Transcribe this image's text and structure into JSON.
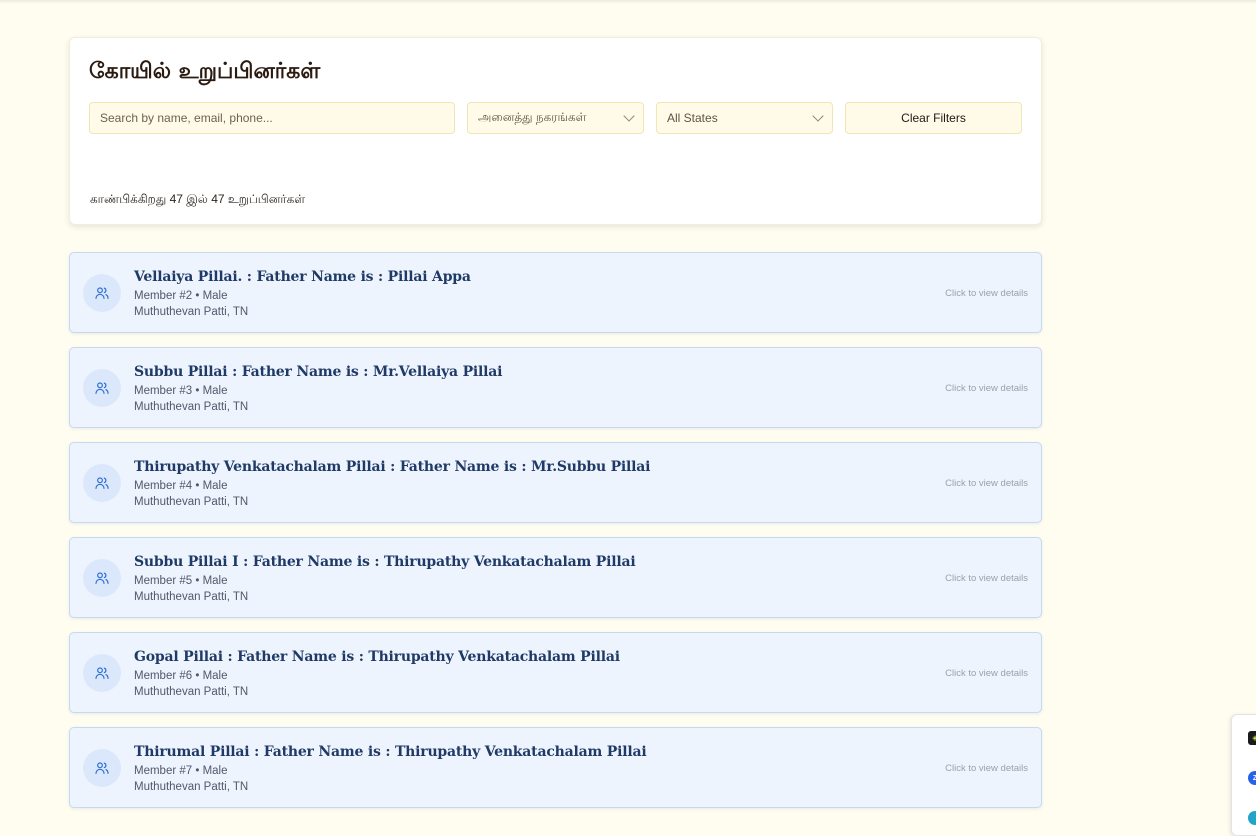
{
  "page": {
    "title": "கோயில் உறுப்பினர்கள்",
    "search_placeholder": "Search by name, email, phone...",
    "city_filter": "அனைத்து நகரங்கள்",
    "state_filter": "All States",
    "clear_label": "Clear Filters",
    "count_text": "காண்பிக்கிறது 47 இல் 47 உறுப்பினர்கள்"
  },
  "members": [
    {
      "name": "Vellaiya Pillai. : Father Name is : Pillai Appa",
      "meta": "Member #2 • Male",
      "place": "Muthuthevan Patti, TN",
      "hint": "Click to view details"
    },
    {
      "name": "Subbu Pillai : Father Name is : Mr.Vellaiya Pillai",
      "meta": "Member #3 • Male",
      "place": "Muthuthevan Patti, TN",
      "hint": "Click to view details"
    },
    {
      "name": "Thirupathy Venkatachalam Pillai : Father Name is : Mr.Subbu Pillai",
      "meta": "Member #4 • Male",
      "place": "Muthuthevan Patti, TN",
      "hint": "Click to view details"
    },
    {
      "name": "Subbu Pillai I : Father Name is : Thirupathy Venkatachalam Pillai",
      "meta": "Member #5 • Male",
      "place": "Muthuthevan Patti, TN",
      "hint": "Click to view details"
    },
    {
      "name": "Gopal Pillai : Father Name is : Thirupathy Venkatachalam Pillai",
      "meta": "Member #6 • Male",
      "place": "Muthuthevan Patti, TN",
      "hint": "Click to view details"
    },
    {
      "name": "Thirumal Pillai : Father Name is : Thirupathy Venkatachalam Pillai",
      "meta": "Member #7 • Male",
      "place": "Muthuthevan Patti, TN",
      "hint": "Click to view details"
    }
  ],
  "icons": {
    "member_avatar": "users-icon",
    "dropdown": "chevron-down-icon"
  },
  "colors": {
    "background": "#fffdf0",
    "card_bg": "#eef4fe",
    "name_text": "#1f3a66",
    "accent_blue": "#2f6fd6"
  }
}
